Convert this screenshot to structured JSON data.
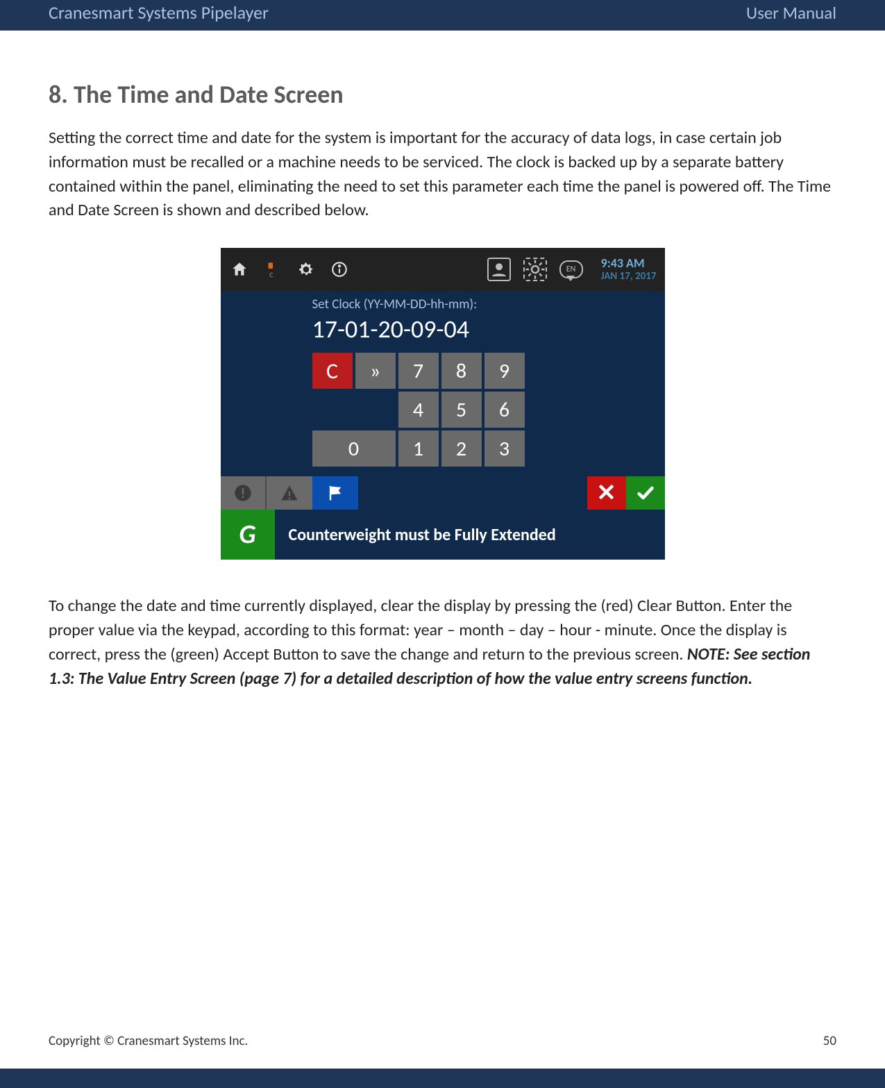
{
  "header": {
    "left": "Cranesmart Systems Pipelayer",
    "right": "User Manual"
  },
  "section": {
    "title": "8. The Time and Date Screen",
    "intro": "Setting the correct time and date for the system is important for the accuracy of data logs, in case certain job information must be recalled or a machine needs to be serviced.  The clock is backed up by a separate battery contained within the panel, eliminating the need to set this parameter each time the panel is powered off.  The Time and Date Screen is shown and described below.",
    "outro_plain": "To change the date and time currently displayed, clear the display by pressing the (red) Clear Button. Enter the proper value via the keypad, according to this format: year – month – day – hour - minute. Once the display is correct, press the (green) Accept Button to save the change and return to the previous screen.  ",
    "outro_note": "NOTE: See section 1.3: The Value Entry Screen (page 7) for a detailed description of how the value entry screens function."
  },
  "device": {
    "clock": {
      "time": "9:43 AM",
      "date": "JAN 17, 2017"
    },
    "toolbar_lang": "EN",
    "set_label": "Set Clock (YY-MM-DD-hh-mm):",
    "set_value": "17-01-20-09-04",
    "keys": {
      "clear": "C",
      "next": "»",
      "k7": "7",
      "k8": "8",
      "k9": "9",
      "k4": "4",
      "k5": "5",
      "k6": "6",
      "k0": "0",
      "k1": "1",
      "k2": "2",
      "k3": "3"
    },
    "cancel": "✕",
    "accept": "✓",
    "status_icon": "G",
    "status_msg": "Counterweight must be Fully Extended"
  },
  "footer": {
    "copyright": "Copyright © Cranesmart Systems Inc.",
    "page": "50"
  }
}
